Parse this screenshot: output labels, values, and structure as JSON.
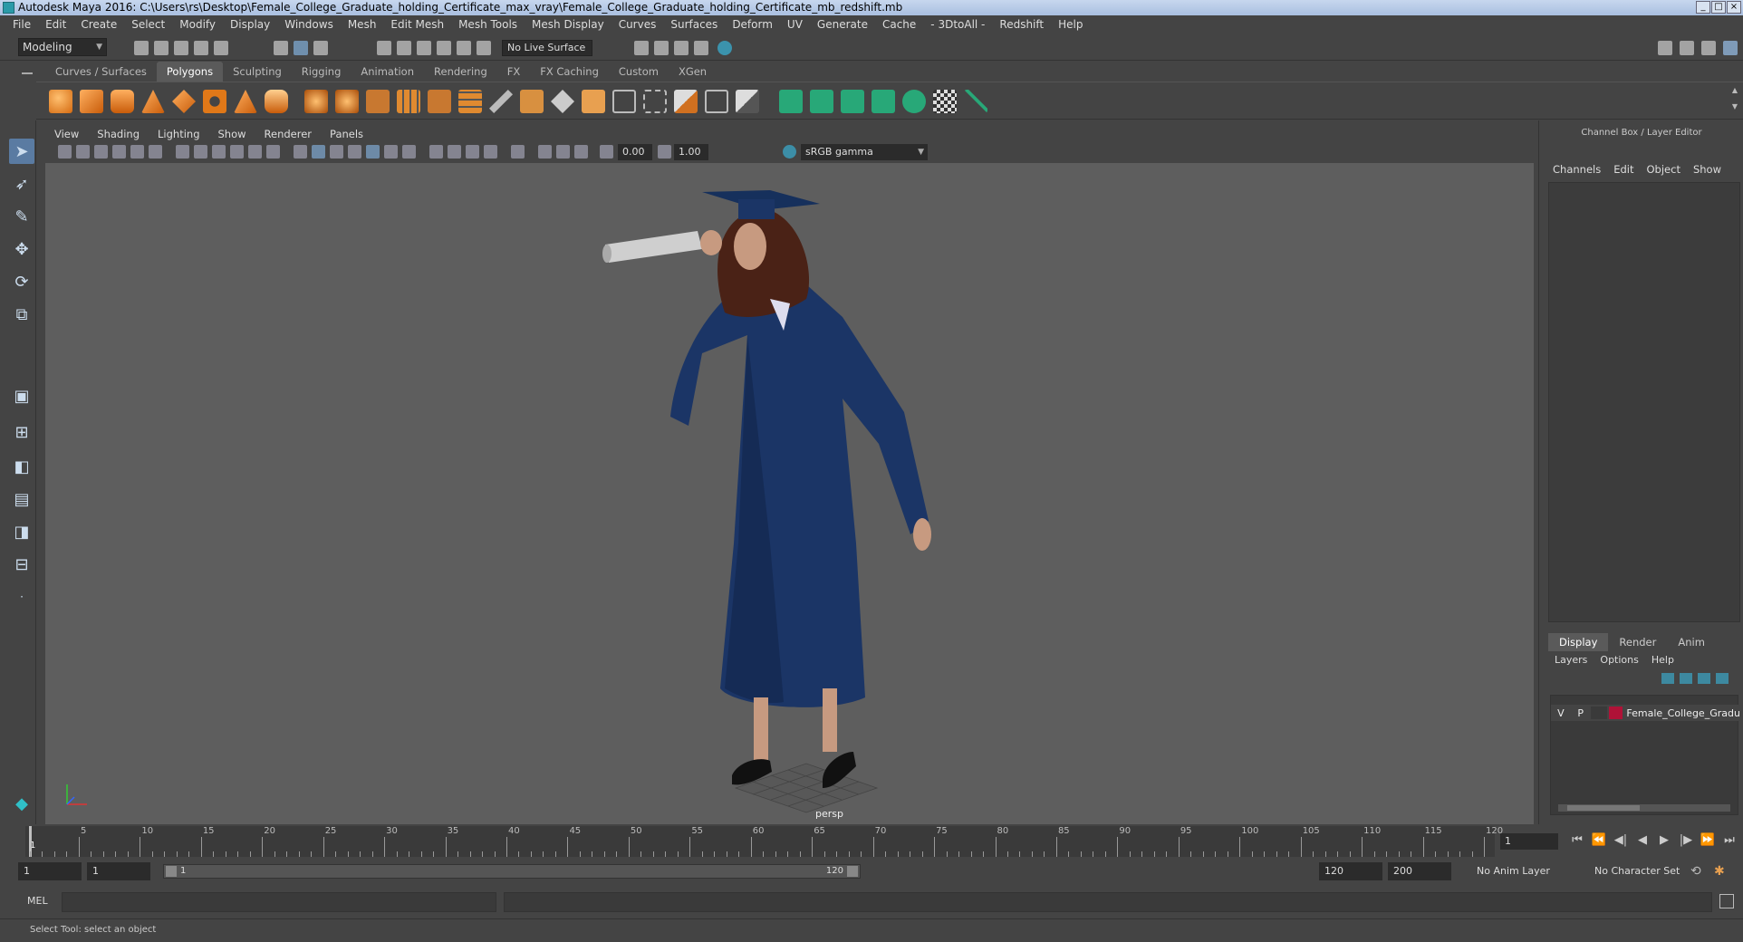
{
  "window": {
    "title": "Autodesk Maya 2016: C:\\Users\\rs\\Desktop\\Female_College_Graduate_holding_Certificate_max_vray\\Female_College_Graduate_holding_Certificate_mb_redshift.mb"
  },
  "menu": [
    "File",
    "Edit",
    "Create",
    "Select",
    "Modify",
    "Display",
    "Windows",
    "Mesh",
    "Edit Mesh",
    "Mesh Tools",
    "Mesh Display",
    "Curves",
    "Surfaces",
    "Deform",
    "UV",
    "Generate",
    "Cache",
    "- 3DtoAll -",
    "Redshift",
    "Help"
  ],
  "status_line": {
    "mode": "Modeling",
    "live_surface": "No Live Surface"
  },
  "shelf": {
    "tabs": [
      "Curves / Surfaces",
      "Polygons",
      "Sculpting",
      "Rigging",
      "Animation",
      "Rendering",
      "FX",
      "FX Caching",
      "Custom",
      "XGen"
    ],
    "active_tab": "Polygons"
  },
  "panel": {
    "menu": [
      "View",
      "Shading",
      "Lighting",
      "Show",
      "Renderer",
      "Panels"
    ],
    "exposure": "0.00",
    "gamma_value": "1.00",
    "color_space": "sRGB gamma",
    "camera": "persp"
  },
  "channel_box": {
    "title": "Channel Box / Layer Editor",
    "menu": [
      "Channels",
      "Edit",
      "Object",
      "Show"
    ],
    "layer_tabs": [
      "Display",
      "Render",
      "Anim"
    ],
    "active_layer_tab": "Display",
    "layer_menu": [
      "Layers",
      "Options",
      "Help"
    ],
    "layer": {
      "v": "V",
      "p": "P",
      "name": "Female_College_Gradu",
      "color": "#b01237"
    }
  },
  "timeline": {
    "ticks": [
      "5",
      "10",
      "15",
      "20",
      "25",
      "30",
      "35",
      "40",
      "45",
      "50",
      "55",
      "60",
      "65",
      "70",
      "75",
      "80",
      "85",
      "90",
      "95",
      "100",
      "105",
      "110",
      "115",
      "120"
    ],
    "start_label": "1",
    "current_frame": "1"
  },
  "range": {
    "start": "1",
    "playback_start": "1",
    "slider_left": "1",
    "slider_right": "120",
    "playback_end": "120",
    "end": "200",
    "anim_layer": "No Anim Layer",
    "character_set": "No Character Set"
  },
  "command_line": {
    "label": "MEL"
  },
  "help_line": "Select Tool: select an object",
  "colors": {
    "accent": "#5a7ba2",
    "viewport": "#5e5e5e",
    "robe": "#1b3566"
  }
}
